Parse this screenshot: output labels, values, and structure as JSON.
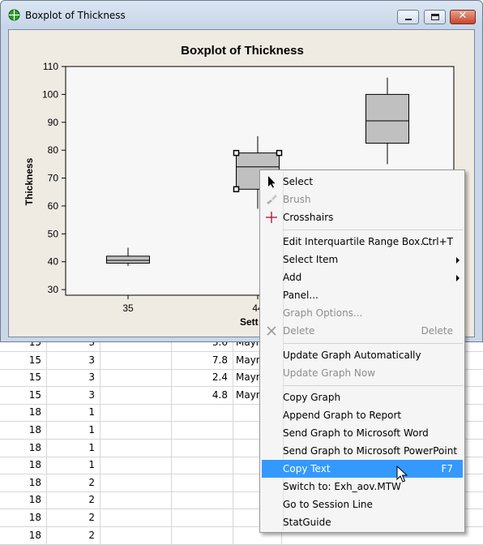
{
  "window": {
    "title": "Boxplot of Thickness"
  },
  "chart_data": {
    "type": "boxplot",
    "title": "Boxplot of Thickness",
    "ylabel": "Thickness",
    "xlabel": "Sett",
    "ylim": [
      28,
      110
    ],
    "yticks": [
      30,
      40,
      50,
      60,
      70,
      80,
      90,
      100,
      110
    ],
    "categories": [
      "35",
      "44",
      ""
    ],
    "boxes": [
      {
        "category": "35",
        "whisker_low": 38.5,
        "q1": 39.5,
        "median": 40.5,
        "q3": 42,
        "whisker_high": 45
      },
      {
        "category": "44",
        "whisker_low": 59,
        "q1": 66,
        "median": 74,
        "q3": 79,
        "whisker_high": 85,
        "selected": true
      },
      {
        "category": "",
        "whisker_low": 75,
        "q1": 82.5,
        "median": 90.5,
        "q3": 100,
        "whisker_high": 106
      }
    ]
  },
  "worksheet": {
    "rows": [
      [
        "15",
        "3",
        "",
        "3.6",
        "Mayn"
      ],
      [
        "15",
        "3",
        "",
        "7.8",
        "Mayn"
      ],
      [
        "15",
        "3",
        "",
        "2.4",
        "Mayn"
      ],
      [
        "15",
        "3",
        "",
        "4.8",
        "Mayn"
      ],
      [
        "18",
        "1",
        "",
        "",
        ""
      ],
      [
        "18",
        "1",
        "",
        "",
        ""
      ],
      [
        "18",
        "1",
        "",
        "",
        ""
      ],
      [
        "18",
        "1",
        "",
        "",
        ""
      ],
      [
        "18",
        "2",
        "",
        "",
        ""
      ],
      [
        "18",
        "2",
        "",
        "",
        ""
      ],
      [
        "18",
        "2",
        "",
        "",
        ""
      ],
      [
        "18",
        "2",
        "",
        "",
        ""
      ]
    ]
  },
  "context_menu": {
    "items": [
      {
        "label": "Select",
        "icon": "arrow-pointer-icon"
      },
      {
        "label": "Brush",
        "icon": "brush-icon",
        "disabled": true
      },
      {
        "label": "Crosshairs",
        "icon": "crosshairs-icon"
      },
      {
        "separator": true
      },
      {
        "label": "Edit Interquartile Range Box...",
        "shortcut": "Ctrl+T"
      },
      {
        "label": "Select Item",
        "submenu": true
      },
      {
        "label": "Add",
        "submenu": true
      },
      {
        "label": "Panel..."
      },
      {
        "label": "Graph Options...",
        "disabled": true
      },
      {
        "label": "Delete",
        "icon": "delete-x-icon",
        "shortcut": "Delete",
        "disabled": true
      },
      {
        "separator": true
      },
      {
        "label": "Update Graph Automatically"
      },
      {
        "label": "Update Graph Now",
        "disabled": true
      },
      {
        "separator": true
      },
      {
        "label": "Copy Graph"
      },
      {
        "label": "Append Graph to Report"
      },
      {
        "label": "Send Graph to Microsoft Word"
      },
      {
        "label": "Send Graph to Microsoft PowerPoint"
      },
      {
        "label": "Copy Text",
        "shortcut": "F7",
        "highlighted": true
      },
      {
        "label": "Switch to: Exh_aov.MTW"
      },
      {
        "label": "Go to Session Line"
      },
      {
        "label": "StatGuide"
      }
    ]
  },
  "colors": {
    "box_fill": "#c0c0c0",
    "plot_bg": "#f7f7f7",
    "figure_bg": "#f0ebe2",
    "highlight": "#3399ff"
  }
}
